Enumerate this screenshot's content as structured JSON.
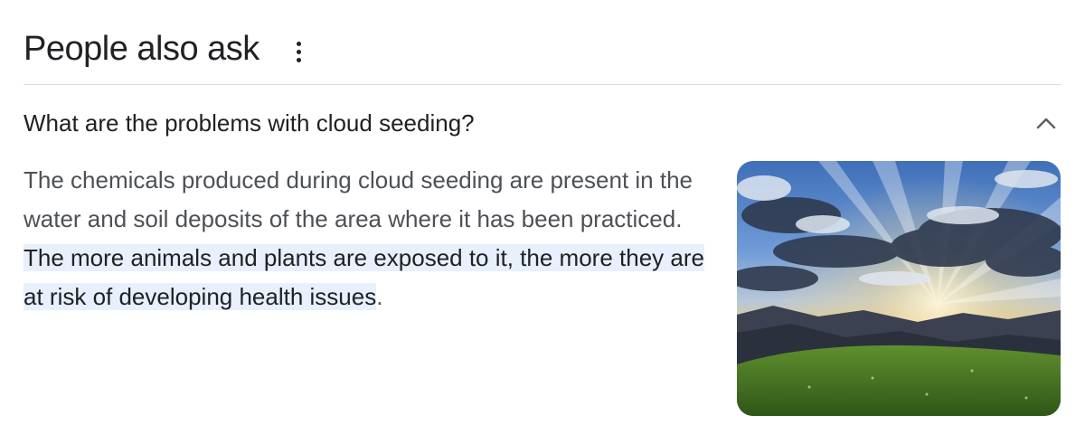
{
  "section": {
    "title": "People also ask",
    "more_icon": "more-vert-icon"
  },
  "question": {
    "text": "What are the problems with cloud seeding?",
    "expanded": true,
    "chevron_icon": "chevron-up-icon"
  },
  "answer": {
    "plain_text": "The chemicals produced during cloud seeding are present in the water and soil deposits of the area where it has been practiced. ",
    "highlighted_text": "The more animals and plants are exposed to it, the more they are at risk of developing health issues",
    "trailing_text": ".",
    "highlight_color": "#e8f0fe"
  },
  "image": {
    "subject": "sun rays through dramatic clouds over green mountain landscape"
  },
  "colors": {
    "text_primary": "#202124",
    "text_secondary": "#4d5156",
    "divider": "#dadce0"
  }
}
